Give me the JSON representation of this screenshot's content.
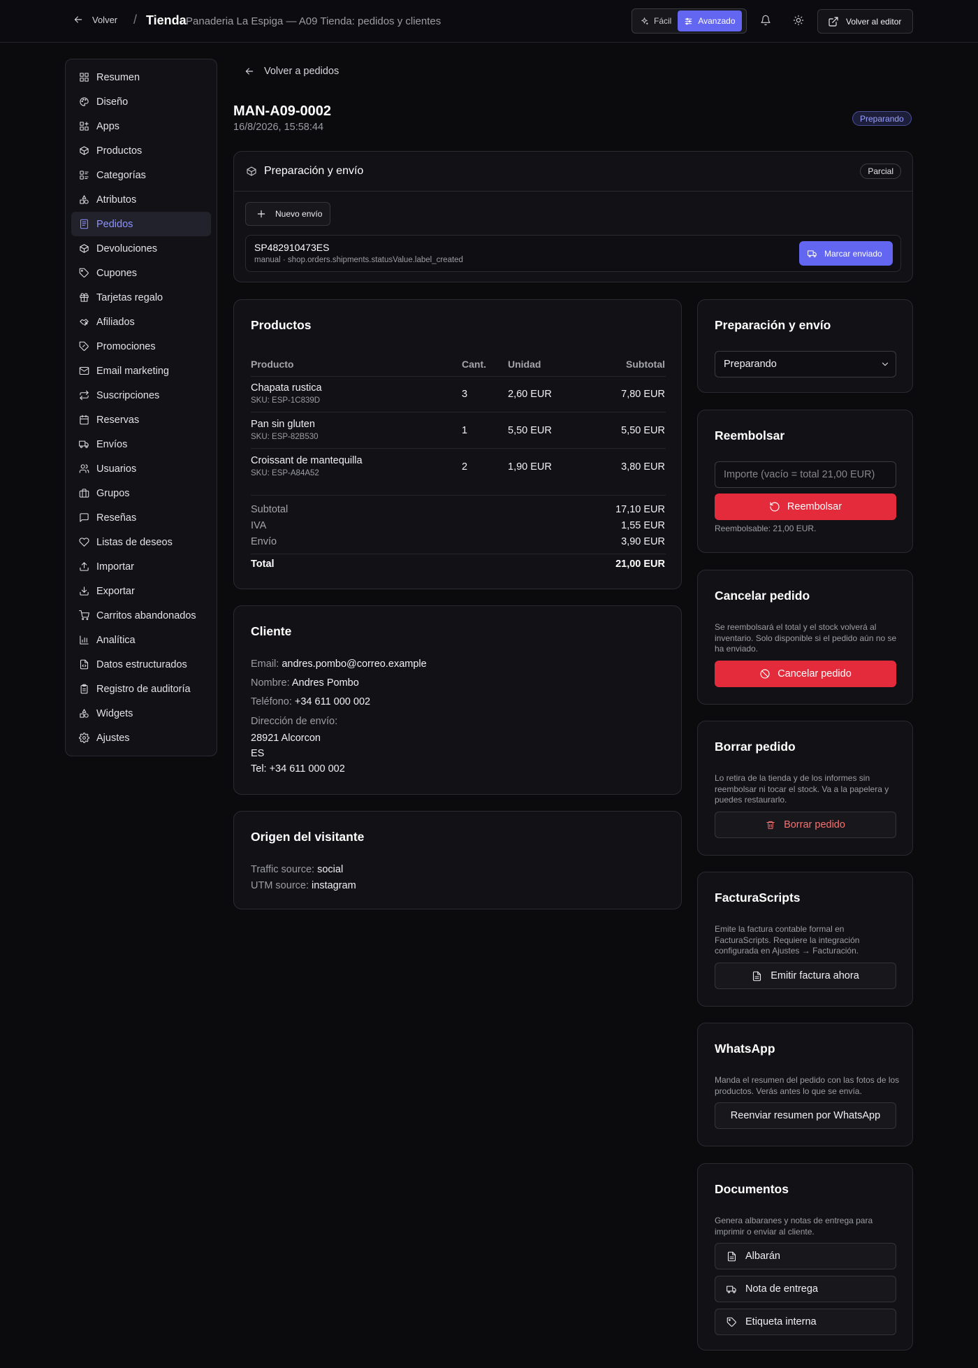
{
  "header": {
    "back_label": "Volver",
    "separator": "/",
    "brand": "Tienda",
    "subtitle": "Panaderia La Espiga — A09 Tienda: pedidos y clientes",
    "mode_easy": "Fácil",
    "mode_advanced": "Avanzado",
    "mode_active": "advanced",
    "editor_button": "Volver al editor"
  },
  "sidebar": {
    "items": [
      {
        "label": "Resumen",
        "icon": "grid-icon"
      },
      {
        "label": "Diseño",
        "icon": "palette-icon"
      },
      {
        "label": "Apps",
        "icon": "apps-icon"
      },
      {
        "label": "Productos",
        "icon": "box-icon"
      },
      {
        "label": "Categorías",
        "icon": "categories-icon"
      },
      {
        "label": "Atributos",
        "icon": "shapes-icon"
      },
      {
        "label": "Pedidos",
        "icon": "receipt-icon",
        "active": true
      },
      {
        "label": "Devoluciones",
        "icon": "box-return-icon"
      },
      {
        "label": "Cupones",
        "icon": "tag-icon"
      },
      {
        "label": "Tarjetas regalo",
        "icon": "gift-icon"
      },
      {
        "label": "Afiliados",
        "icon": "handshake-icon"
      },
      {
        "label": "Promociones",
        "icon": "percent-tag-icon"
      },
      {
        "label": "Email marketing",
        "icon": "mail-icon"
      },
      {
        "label": "Suscripciones",
        "icon": "repeat-icon"
      },
      {
        "label": "Reservas",
        "icon": "calendar-icon"
      },
      {
        "label": "Envíos",
        "icon": "truck-icon"
      },
      {
        "label": "Usuarios",
        "icon": "users-icon"
      },
      {
        "label": "Grupos",
        "icon": "briefcase-icon"
      },
      {
        "label": "Reseñas",
        "icon": "message-icon"
      },
      {
        "label": "Listas de deseos",
        "icon": "heart-icon"
      },
      {
        "label": "Importar",
        "icon": "upload-icon"
      },
      {
        "label": "Exportar",
        "icon": "download-icon"
      },
      {
        "label": "Carritos abandonados",
        "icon": "cart-icon"
      },
      {
        "label": "Analítica",
        "icon": "bar-chart-icon"
      },
      {
        "label": "Datos estructurados",
        "icon": "file-code-icon"
      },
      {
        "label": "Registro de auditoría",
        "icon": "clipboard-icon"
      },
      {
        "label": "Widgets",
        "icon": "widgets-icon"
      },
      {
        "label": "Ajustes",
        "icon": "gear-icon"
      }
    ]
  },
  "order": {
    "back_label": "Volver a pedidos",
    "id": "MAN-A09-0002",
    "date": "16/8/2026, 15:58:44",
    "status": "Preparando",
    "status_color": "#9aa0ff"
  },
  "shipping": {
    "title": "Preparación y envío",
    "badge": "Parcial",
    "new_button": "Nuevo envío",
    "shipment": {
      "tracking": "SP482910473ES",
      "meta": "manual · shop.orders.shipments.statusValue.label_created",
      "action": "Marcar enviado"
    }
  },
  "products": {
    "title": "Productos",
    "columns": [
      "Producto",
      "Cant.",
      "Unidad",
      "Subtotal"
    ],
    "rows": [
      {
        "name": "Chapata rustica",
        "sku": "SKU: ESP-1C839D",
        "qty": "3",
        "unit": "2,60 EUR",
        "subtotal": "7,80 EUR"
      },
      {
        "name": "Pan sin gluten",
        "sku": "SKU: ESP-82B530",
        "qty": "1",
        "unit": "5,50 EUR",
        "subtotal": "5,50 EUR"
      },
      {
        "name": "Croissant de mantequilla",
        "sku": "SKU: ESP-A84A52",
        "qty": "2",
        "unit": "1,90 EUR",
        "subtotal": "3,80 EUR"
      }
    ],
    "totals": [
      {
        "label": "Subtotal",
        "value": "17,10 EUR"
      },
      {
        "label": "IVA",
        "value": "1,55 EUR"
      },
      {
        "label": "Envío",
        "value": "3,90 EUR"
      },
      {
        "label": "Total",
        "value": "21,00 EUR"
      }
    ]
  },
  "client": {
    "title": "Cliente",
    "email_label": "Email:",
    "email": "andres.pombo@correo.example",
    "name_label": "Nombre:",
    "name": "Andres Pombo",
    "phone_label": "Teléfono:",
    "phone": "+34 611 000 002",
    "address_label": "Dirección de envío:",
    "address_lines": [
      "28921 Alcorcon",
      "ES",
      "Tel: +34 611 000 002"
    ]
  },
  "origin": {
    "title": "Origen del visitante",
    "traffic_label": "Traffic source:",
    "traffic": "social",
    "utm_label": "UTM source:",
    "utm": "instagram"
  },
  "status_panel": {
    "title": "Preparación y envío",
    "selected": "Preparando"
  },
  "refund": {
    "title": "Reembolsar",
    "placeholder": "Importe (vacío = total 21,00 EUR)",
    "button": "Reembolsar",
    "note": "Reembolsable: 21,00 EUR."
  },
  "cancel": {
    "title": "Cancelar pedido",
    "description": "Se reembolsará el total y el stock volverá al inventario. Solo disponible si el pedido aún no se ha enviado.",
    "button": "Cancelar pedido"
  },
  "delete": {
    "title": "Borrar pedido",
    "description": "Lo retira de la tienda y de los informes sin reembolsar ni tocar el stock. Va a la papelera y puedes restaurarlo.",
    "button": "Borrar pedido"
  },
  "invoice": {
    "title": "FacturaScripts",
    "description": "Emite la factura contable formal en FacturaScripts. Requiere la integración configurada en Ajustes → Facturación.",
    "button": "Emitir factura ahora"
  },
  "whatsapp": {
    "title": "WhatsApp",
    "description": "Manda el resumen del pedido con las fotos de los productos. Verás antes lo que se envía.",
    "button": "Reenviar resumen por WhatsApp"
  },
  "documents": {
    "title": "Documentos",
    "description": "Genera albaranes y notas de entrega para imprimir o enviar al cliente.",
    "buttons": [
      "Albarán",
      "Nota de entrega",
      "Etiqueta interna"
    ]
  },
  "colors": {
    "accent": "#6366f1",
    "danger": "#e32b3c",
    "background": "#0b0b0e",
    "card": "#121216"
  }
}
